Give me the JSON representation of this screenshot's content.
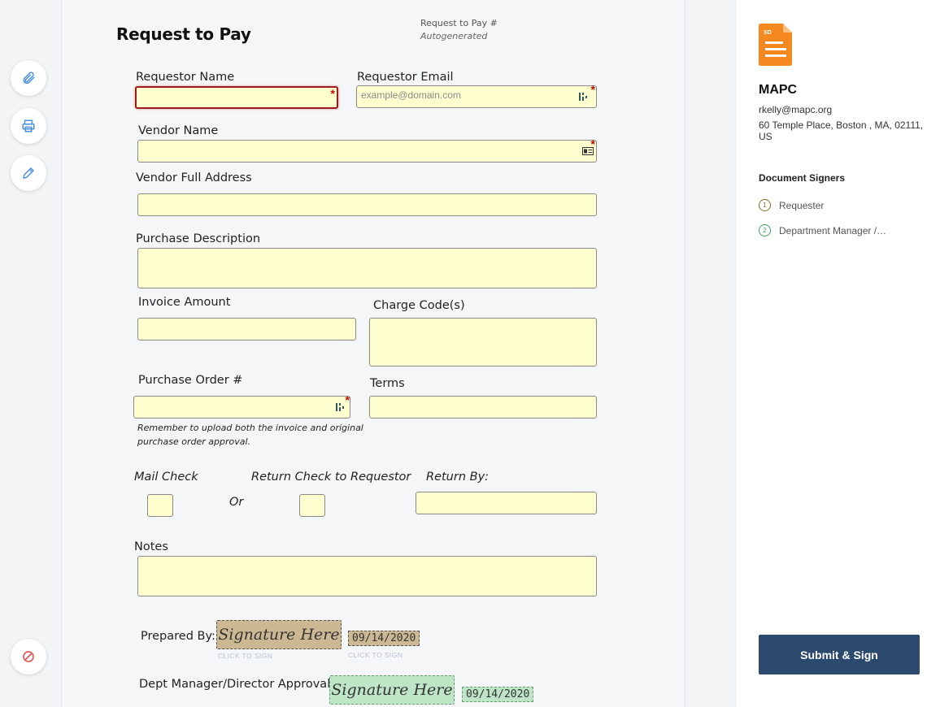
{
  "rail": {
    "icons": [
      "paperclip-icon",
      "printer-icon",
      "pencil-icon",
      "decline-icon"
    ]
  },
  "document": {
    "title": "Request to Pay",
    "rtp_number_label": "Request to Pay #",
    "rtp_number_value": "Autogenerated",
    "labels": {
      "requestor_name": "Requestor Name",
      "requestor_email": "Requestor Email",
      "vendor_name": "Vendor Name",
      "vendor_address": "Vendor Full Address",
      "purchase_description": "Purchase Description",
      "invoice_amount": "Invoice Amount",
      "charge_codes": "Charge Code(s)",
      "purchase_order": "Purchase Order #",
      "terms": "Terms",
      "mail_check": "Mail Check",
      "or": "Or",
      "return_check": "Return Check to Requestor",
      "return_by": "Return By:",
      "notes": "Notes",
      "prepared_by": "Prepared By:",
      "dept_approval": "Dept Manager/Director Approval:"
    },
    "placeholders": {
      "requestor_email": "example@domain.com"
    },
    "po_note_line1": "Remember to upload both the invoice and original",
    "po_note_line2": "purchase order approval.",
    "signature_text": "Signature Here",
    "click_to_sign": "CLICK TO SIGN",
    "prepared_date": "09/14/2020",
    "approval_date": "09/14/2020",
    "required_marker": "*"
  },
  "panel": {
    "file_badge": "SD",
    "org_name": "MAPC",
    "email": "rkelly@mapc.org",
    "address_line1": "60 Temple Place, Boston , MA, 02111,",
    "address_line2": "US",
    "signers_heading": "Document Signers",
    "signers": [
      {
        "num": "1",
        "name": "Requester",
        "color": "#8a6d2a"
      },
      {
        "num": "2",
        "name": "Department Manager /…",
        "color": "#3aa55a"
      }
    ],
    "submit_label": "Submit & Sign"
  },
  "colors": {
    "field_bg": "#ffffcf",
    "submit_bg": "#2c4a6e",
    "sig_prepared": "#cdb894",
    "sig_approval": "#bfe5c7",
    "required": "#cc0000",
    "file_orange": "#f5891f"
  }
}
